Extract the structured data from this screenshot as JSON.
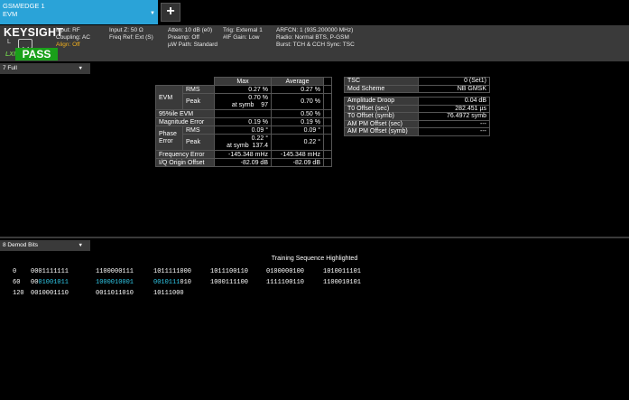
{
  "mode_tab": {
    "line1": "GSM/EDGE 1",
    "line2": "EVM"
  },
  "add_label": "+",
  "meas_bar": {
    "logo": "KEYSIGHT",
    "logo_sub": "L",
    "lxi": "LXI",
    "status": "PASS",
    "g1": [
      "Input: RF",
      "Coupling: AC",
      "Align: Off"
    ],
    "g2": [
      "Input Z: 50 Ω",
      "Freq Ref: Ext (S)"
    ],
    "g3": [
      "Atten: 10 dB (e0)",
      "Preamp: Off",
      "µW Path: Standard"
    ],
    "g4": [
      "Trig: External 1",
      "#IF Gain: Low"
    ],
    "g5": [
      "ARFCN: 1  (935.200000 MHz)",
      "Radio: Normal BTS, P-GSM",
      "Burst: TCH & CCH     Sync: TSC"
    ]
  },
  "window1": {
    "label": "7 Full"
  },
  "window2": {
    "label": "8 Demod Bits"
  },
  "evm": {
    "col_max": "Max",
    "col_avg": "Average",
    "evm_label": "EVM",
    "rms_label": "RMS",
    "peak_label": "Peak",
    "evm_rms_max": "0.27 %",
    "evm_rms_avg": "0.27 %",
    "evm_peak_max": "0.70 %",
    "evm_peak_at": "at symb    97",
    "evm_peak_avg": "0.70 %",
    "p95_label": "95%ile EVM",
    "p95_max": "",
    "p95_avg": "0.50 %",
    "mag_label": "Magnitude Error",
    "mag_max": "0.19 %",
    "mag_avg": "0.19 %",
    "phase_label1": "Phase",
    "phase_label2": "Error",
    "phase_rms_max": "0.09 °",
    "phase_rms_avg": "0.09 °",
    "phase_peak_max": "0.22 °",
    "phase_peak_at": "at symb  137.4",
    "phase_peak_avg": "0.22 °",
    "freq_label": "Frequency Error",
    "freq_max": "-145.348 mHz",
    "freq_avg": "-145.348 mHz",
    "iq_label": "I/Q Origin Offset",
    "iq_max": "-82.09 dB",
    "iq_avg": "-82.09 dB"
  },
  "tsc": {
    "rows_top": [
      {
        "label": "TSC",
        "value": "0 (Set1)"
      },
      {
        "label": "Mod Scheme",
        "value": "NB GMSK"
      }
    ],
    "rows_bottom": [
      {
        "label": "Amplitude Droop",
        "value": "0.04 dB"
      },
      {
        "label": "T0 Offset (sec)",
        "value": "282.451 µs"
      },
      {
        "label": "T0 Offset (symb)",
        "value": "76.4972 symb"
      },
      {
        "label": "AM PM Offset (sec)",
        "value": "---"
      },
      {
        "label": "AM PM Offset (symb)",
        "value": "---"
      }
    ]
  },
  "bits": {
    "title": "Training Sequence Highlighted",
    "rows": [
      {
        "index": "0",
        "groups": [
          "0001111111",
          "1100000111",
          "1011111000",
          "1011100110",
          "0100000100",
          "1010011101"
        ]
      },
      {
        "index": "60",
        "groups": [
          "0001001011",
          "1000010001",
          "0010111010",
          "1000111100",
          "1111100110",
          "1100010101"
        ]
      },
      {
        "index": "120",
        "groups": [
          "0010001110",
          "0011011010",
          "10111000"
        ]
      }
    ]
  },
  "colors": {
    "accent": "#2aa3d8",
    "pass": "#1aa01a",
    "highlight": "#30c8e8",
    "warn": "#f2b01e"
  }
}
